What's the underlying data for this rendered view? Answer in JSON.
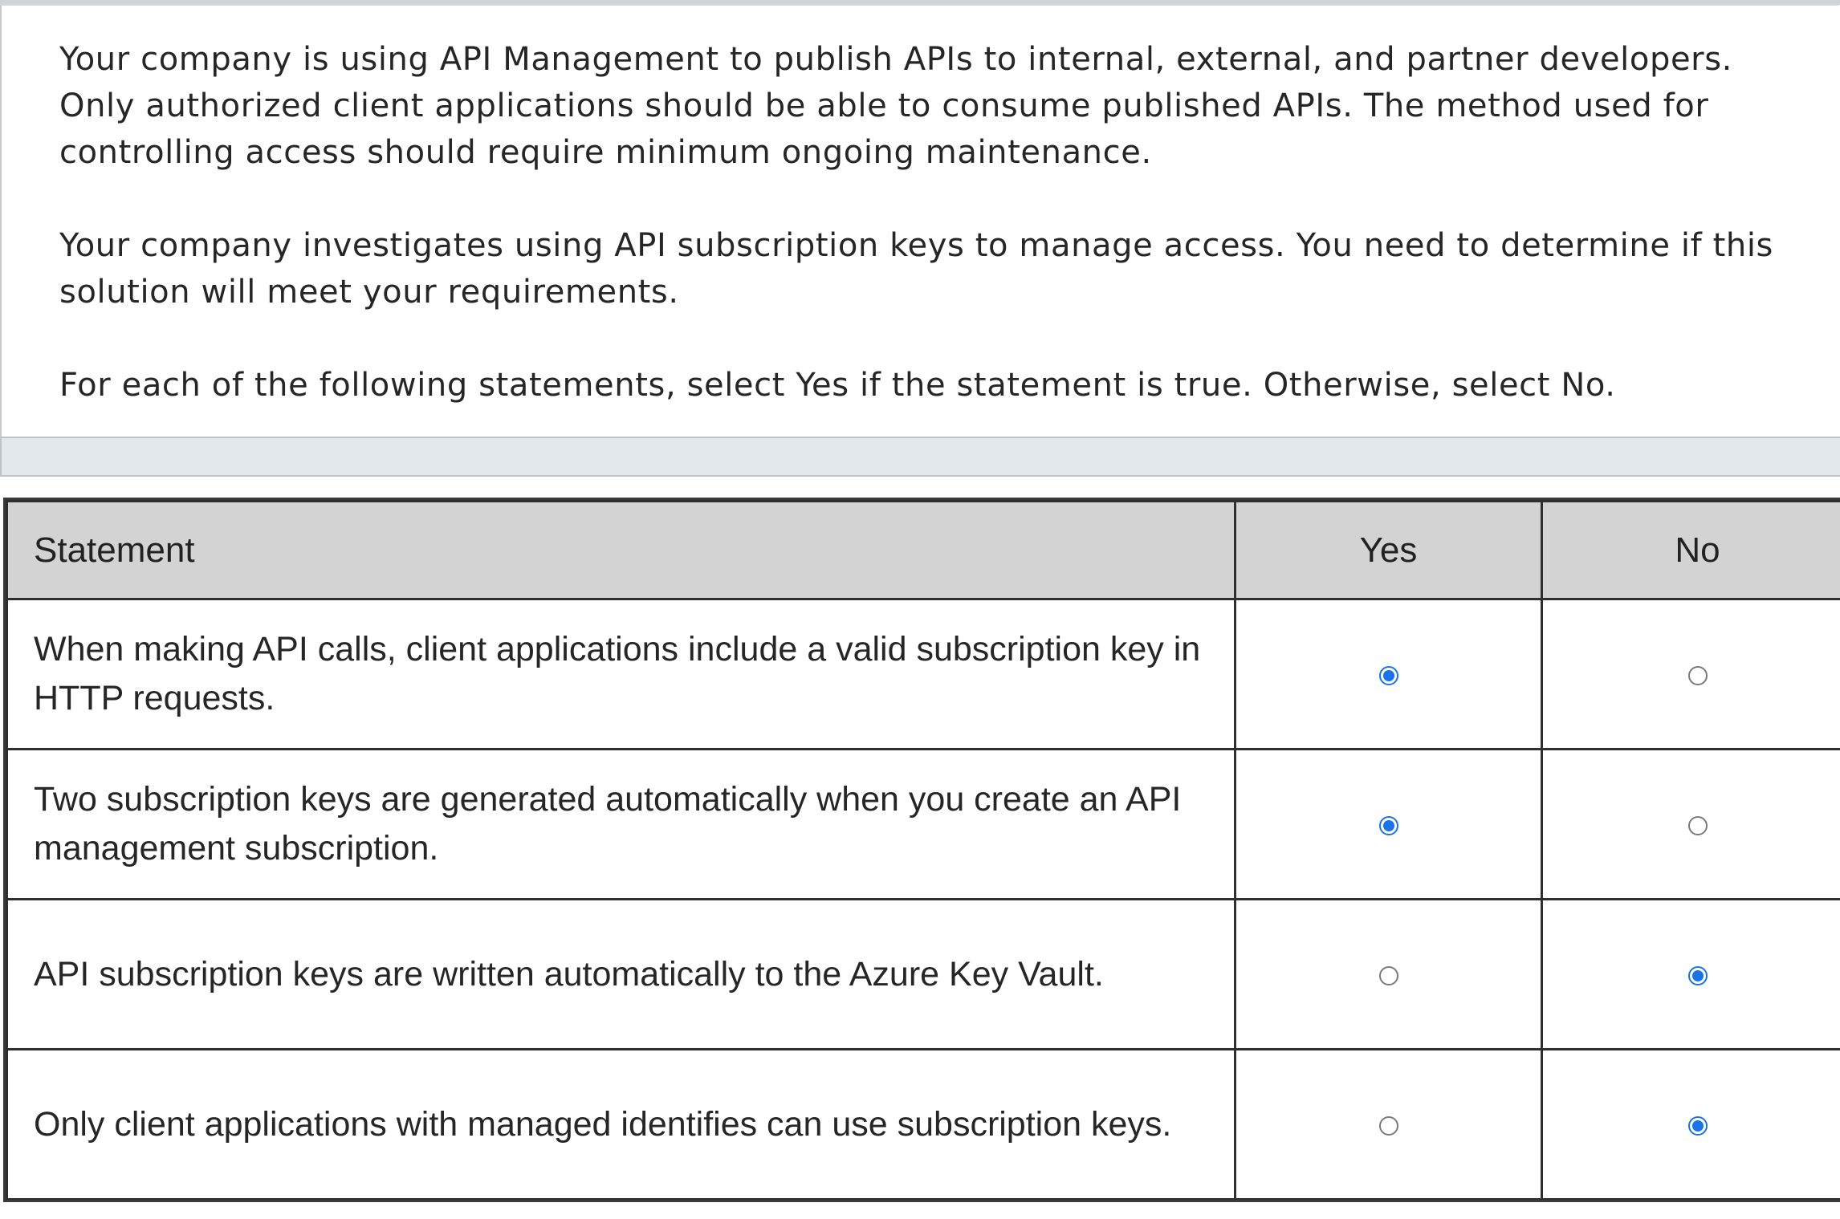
{
  "intro": {
    "paragraph1": "Your company is using API Management to publish APIs to internal, external, and partner developers. Only authorized client applications should be able to consume published APIs. The method used for controlling access should require minimum ongoing maintenance.",
    "paragraph2": "Your company investigates using API subscription keys to manage access. You need to determine if this solution will meet your requirements.",
    "paragraph3": "For each of the following statements, select Yes if the statement is true. Otherwise, select No."
  },
  "table": {
    "headers": {
      "statement": "Statement",
      "yes": "Yes",
      "no": "No"
    },
    "rows": [
      {
        "statement": "When making API calls, client applications include a valid subscription key in HTTP requests.",
        "selected": "yes"
      },
      {
        "statement": "Two subscription keys are generated automatically when you create an API management subscription.",
        "selected": "yes"
      },
      {
        "statement": "API subscription keys are written automatically to the Azure Key Vault.",
        "selected": "no"
      },
      {
        "statement": "Only client applications with managed identifies can use subscription keys.",
        "selected": "no"
      }
    ]
  },
  "colors": {
    "accent": "#1a73e8",
    "header_bg": "#d3d3d3",
    "band_bg": "#e3e8ec"
  }
}
